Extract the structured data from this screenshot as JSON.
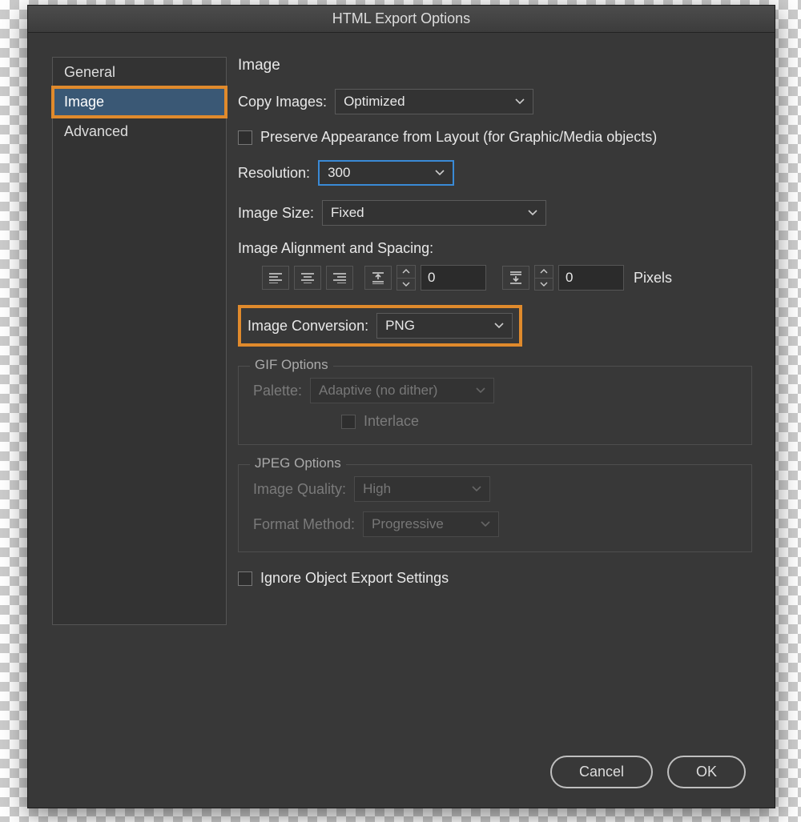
{
  "title": "HTML Export Options",
  "sidebar": {
    "items": [
      {
        "label": "General",
        "selected": false
      },
      {
        "label": "Image",
        "selected": true
      },
      {
        "label": "Advanced",
        "selected": false
      }
    ]
  },
  "panel": {
    "heading": "Image",
    "copy_images_label": "Copy Images:",
    "copy_images_value": "Optimized",
    "preserve_label": "Preserve Appearance from Layout (for Graphic/Media objects)",
    "preserve_checked": false,
    "resolution_label": "Resolution:",
    "resolution_value": "300",
    "image_size_label": "Image Size:",
    "image_size_value": "Fixed",
    "alignment_label": "Image Alignment and Spacing:",
    "space_before_value": "0",
    "space_after_value": "0",
    "pixels_label": "Pixels",
    "conversion_label": "Image Conversion:",
    "conversion_value": "PNG",
    "gif": {
      "legend": "GIF Options",
      "palette_label": "Palette:",
      "palette_value": "Adaptive (no dither)",
      "interlace_label": "Interlace",
      "interlace_checked": false
    },
    "jpeg": {
      "legend": "JPEG Options",
      "quality_label": "Image Quality:",
      "quality_value": "High",
      "method_label": "Format Method:",
      "method_value": "Progressive"
    },
    "ignore_label": "Ignore Object Export Settings",
    "ignore_checked": false
  },
  "footer": {
    "cancel": "Cancel",
    "ok": "OK"
  }
}
